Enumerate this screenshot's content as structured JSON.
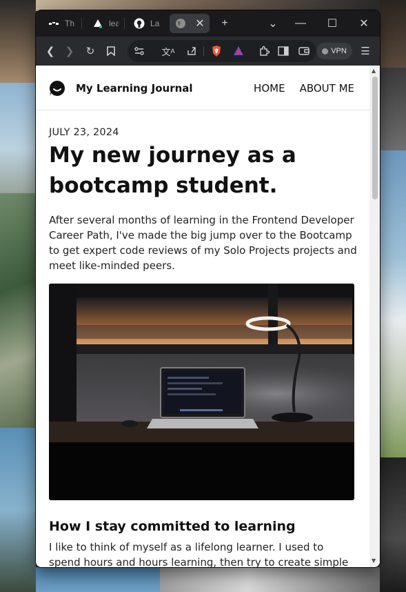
{
  "browser": {
    "tabs": [
      {
        "title": "Th",
        "icon": "tab-dark-logo-icon"
      },
      {
        "title": "lea",
        "icon": "tab-triangle-icon"
      },
      {
        "title": "La",
        "icon": "github-icon"
      },
      {
        "title": "",
        "icon": "globe-icon",
        "active": true
      }
    ],
    "vpn_label": "VPN"
  },
  "site": {
    "title": "My Learning Journal",
    "nav": [
      "HOME",
      "ABOUT ME"
    ]
  },
  "post": {
    "date": "JULY 23, 2024",
    "title": "My new journey as a bootcamp student.",
    "intro": "After several months of learning in the Frontend Developer Career Path, I've made the big jump over to the Bootcamp to get expert code reviews of my Solo Projects projects and meet like-minded peers.",
    "section_heading": "How I stay committed to learning",
    "section_body": "I like to think of myself as a lifelong learner. I used to spend hours and hours learning, then try to create simple projects"
  }
}
